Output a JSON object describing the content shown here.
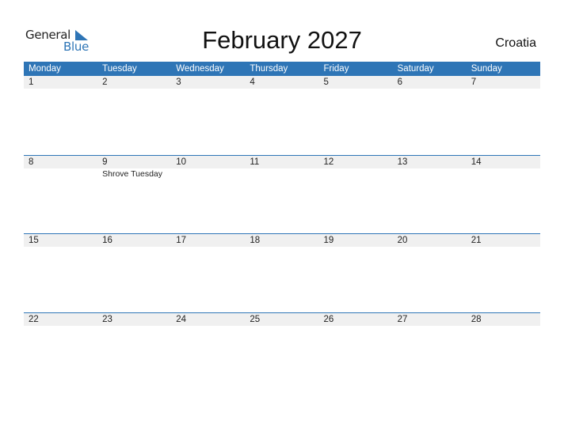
{
  "logo": {
    "line1": "General",
    "line2": "Blue"
  },
  "title": "February 2027",
  "country": "Croatia",
  "colors": {
    "accent": "#2e75b6",
    "date_bar": "#f0f0f0"
  },
  "weekdays": [
    "Monday",
    "Tuesday",
    "Wednesday",
    "Thursday",
    "Friday",
    "Saturday",
    "Sunday"
  ],
  "weeks": [
    {
      "days": [
        "1",
        "2",
        "3",
        "4",
        "5",
        "6",
        "7"
      ],
      "events": [
        "",
        "",
        "",
        "",
        "",
        "",
        ""
      ]
    },
    {
      "days": [
        "8",
        "9",
        "10",
        "11",
        "12",
        "13",
        "14"
      ],
      "events": [
        "",
        "Shrove Tuesday",
        "",
        "",
        "",
        "",
        ""
      ]
    },
    {
      "days": [
        "15",
        "16",
        "17",
        "18",
        "19",
        "20",
        "21"
      ],
      "events": [
        "",
        "",
        "",
        "",
        "",
        "",
        ""
      ]
    },
    {
      "days": [
        "22",
        "23",
        "24",
        "25",
        "26",
        "27",
        "28"
      ],
      "events": [
        "",
        "",
        "",
        "",
        "",
        "",
        ""
      ]
    }
  ]
}
